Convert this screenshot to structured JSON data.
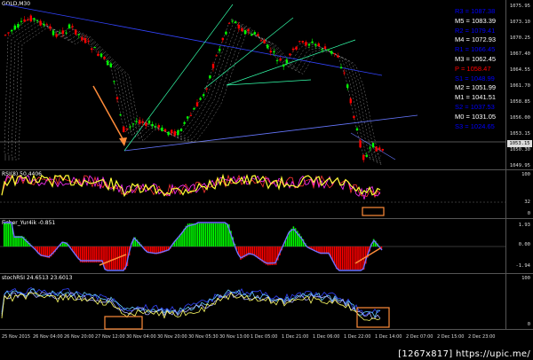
{
  "main": {
    "title": "GOLD,M30",
    "price_ticks": [
      "1075.95",
      "1073.10",
      "1070.25",
      "1067.40",
      "1064.55",
      "1061.70",
      "1058.85",
      "1056.00",
      "1053.15",
      "1050.30",
      "1049.95"
    ],
    "current_price": "1053.15",
    "pivots": [
      {
        "label": "R3 = 1087.38",
        "color": "#0000ff"
      },
      {
        "label": "M5 = 1083.39",
        "color": "#ffffff"
      },
      {
        "label": "R2 = 1079.41",
        "color": "#0000ff"
      },
      {
        "label": "M4 = 1072.93",
        "color": "#ffffff"
      },
      {
        "label": "R1 = 1066.45",
        "color": "#0000ff"
      },
      {
        "label": "M3 = 1062.45",
        "color": "#ffffff"
      },
      {
        "label": "P = 1058.47",
        "color": "#ff0000"
      },
      {
        "label": "S1 = 1048.99",
        "color": "#0000ff"
      },
      {
        "label": "M2 = 1051.99",
        "color": "#ffffff"
      },
      {
        "label": "M1 = 1041.51",
        "color": "#ffffff"
      },
      {
        "label": "S2 = 1037.53",
        "color": "#0000ff"
      },
      {
        "label": "M0 = 1031.05",
        "color": "#ffffff"
      },
      {
        "label": "S3 = 1024.65",
        "color": "#0000ff"
      }
    ]
  },
  "rsi": {
    "title": "RSI(8) 50.4406",
    "ticks": [
      "100",
      "32",
      "0"
    ]
  },
  "fisher": {
    "title": "Fisher_Yur4ik -0.851",
    "ticks": [
      "1.93",
      "0.00",
      "-1.94"
    ]
  },
  "stoch": {
    "title": "stochRSI 24.6513 23.6013",
    "ticks": [
      "100",
      "0"
    ]
  },
  "xaxis": {
    "labels": [
      "25 Nov 2015",
      "26 Nov 04:00",
      "26 Nov 20:00",
      "27 Nov 12:00",
      "30 Nov 04:00",
      "30 Nov 20:00",
      "30 Nov 05:30",
      "30 Nov 13:00",
      "1 Dec 05:00",
      "1 Dec 21:00",
      "1 Dec 06:00",
      "1 Dec 22:00",
      "1 Dec 14:00",
      "2 Dec 07:00",
      "2 Dec 15:00",
      "2 Dec 23:00"
    ]
  },
  "watermark": "[1267x817] https://upic.me/",
  "colors": {
    "bull": "#00ff00",
    "bear": "#ff0000",
    "annotation": "#ff8c3a",
    "trendline": "#4a7aff",
    "rsi": "#ffff33",
    "fisher": "#7070ff",
    "stoch": "#ffff66"
  }
}
